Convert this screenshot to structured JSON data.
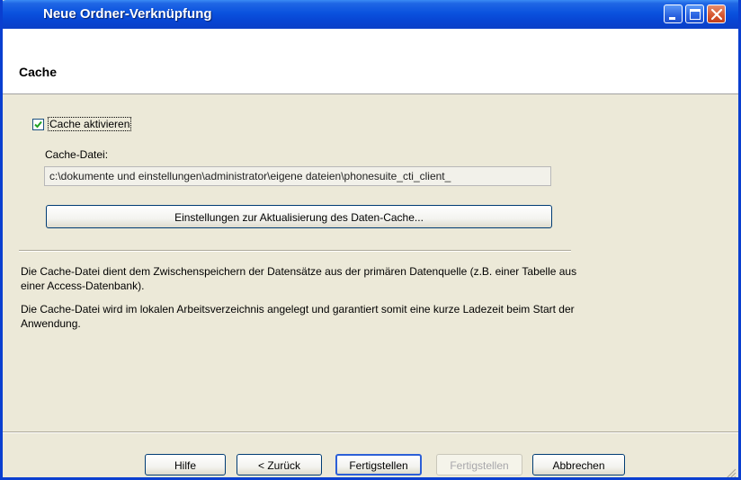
{
  "window": {
    "title": "Neue Ordner-Verknüpfung"
  },
  "header": {
    "title": "Cache"
  },
  "cache": {
    "enable_label": "Cache aktivieren",
    "enabled": true,
    "file_label": "Cache-Datei:",
    "file_path": "c:\\dokumente und einstellungen\\administrator\\eigene dateien\\phonesuite_cti_client_",
    "update_settings_button": "Einstellungen zur Aktualisierung des Daten-Cache..."
  },
  "description": {
    "paragraph1": "Die Cache-Datei dient dem Zwischenspeichern der Datensätze aus der primären Datenquelle (z.B. einer Tabelle aus einer Access-Datenbank).",
    "paragraph2": "Die Cache-Datei wird im lokalen Arbeitsverzeichnis angelegt und garantiert somit eine kurze Ladezeit beim Start der Anwendung."
  },
  "footer": {
    "help": "Hilfe",
    "back": "< Zurück",
    "finish": "Fertigstellen",
    "finish_disabled": "Fertigstellen",
    "cancel": "Abbrechen"
  },
  "colors": {
    "titlebar": "#0a52de",
    "dialog_background": "#ece9d8",
    "close_button": "#d5552f"
  },
  "icons": {
    "minimize": "minimize-icon",
    "maximize": "maximize-icon",
    "close": "close-icon",
    "check": "check-icon",
    "resize_grip": "resize-grip-icon"
  }
}
